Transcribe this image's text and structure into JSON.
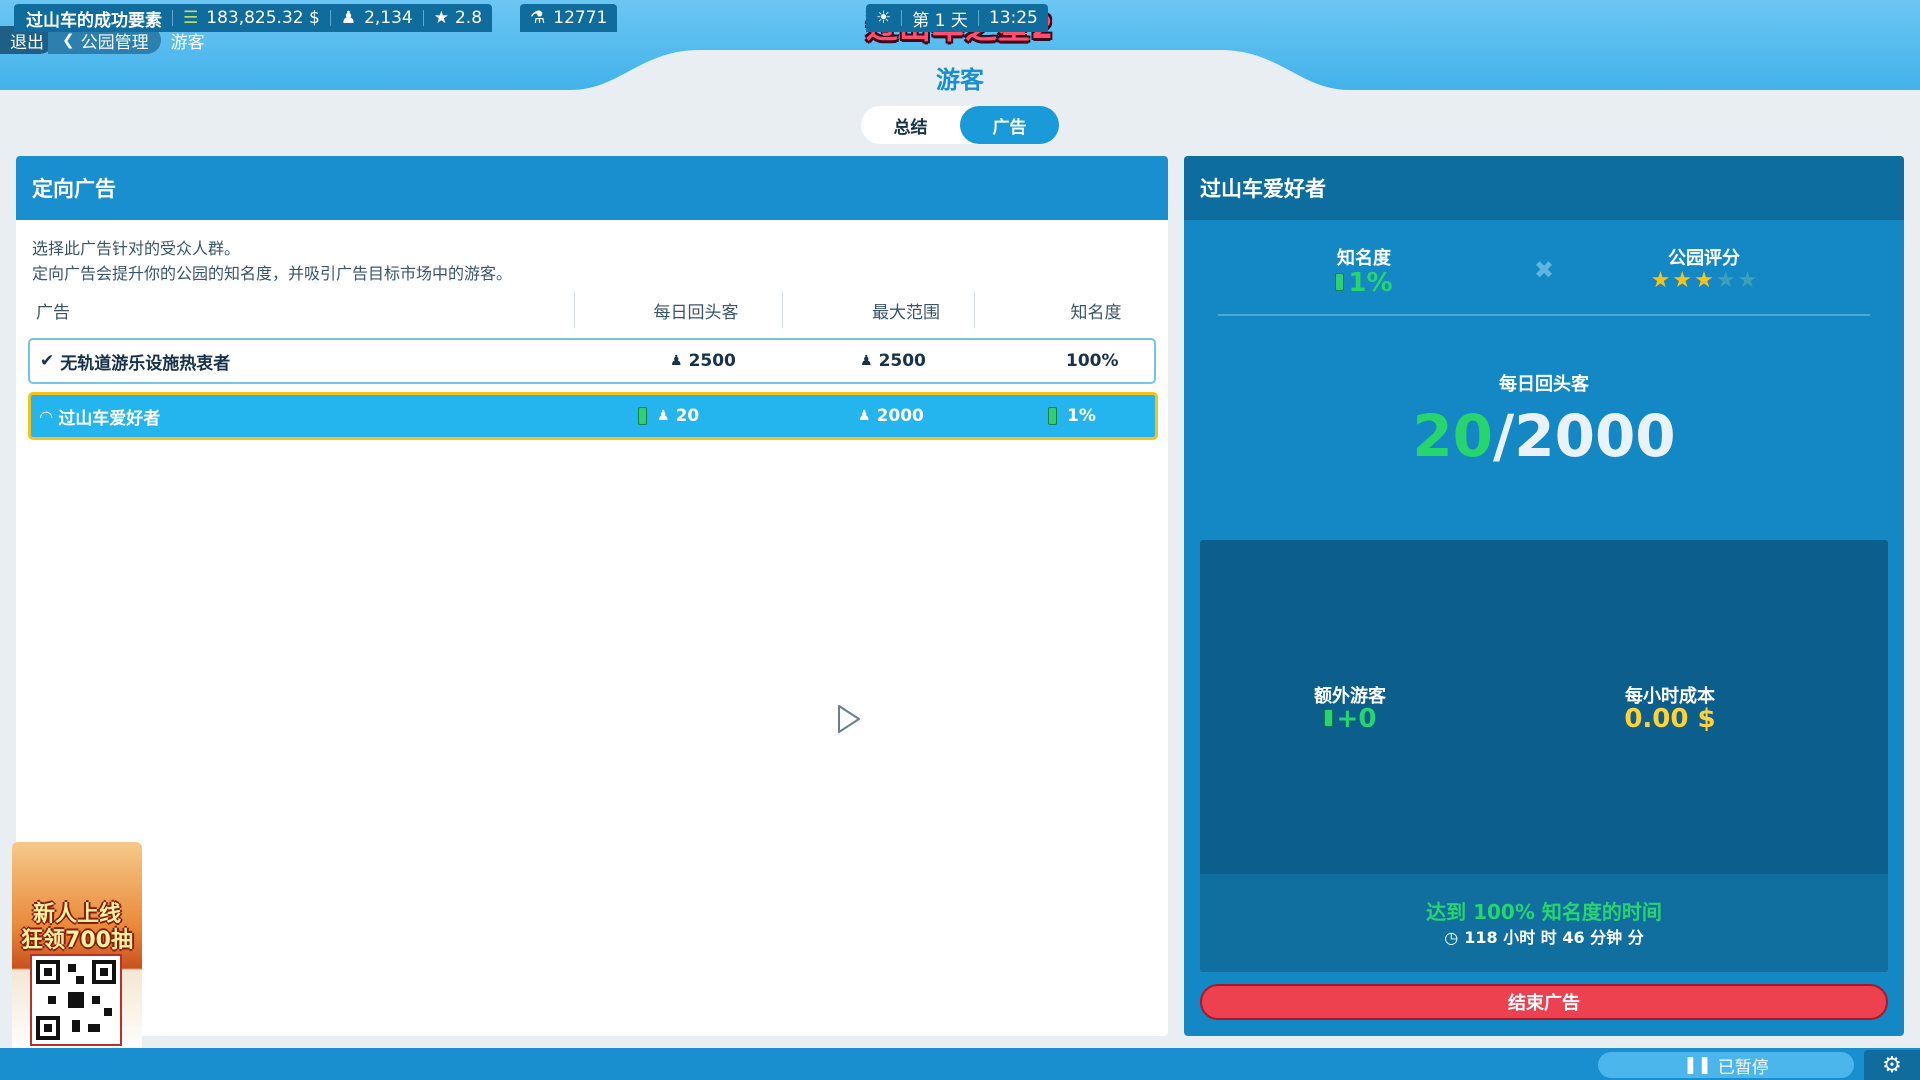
{
  "header": {
    "game_title": "过山车之星2",
    "breadcrumb": {
      "exit": "退出",
      "park_management": "公园管理",
      "current": "游客"
    },
    "page_title": "游客"
  },
  "tabs": [
    {
      "label": "总结",
      "active": false
    },
    {
      "label": "广告",
      "active": true
    }
  ],
  "left_panel": {
    "title": "定向广告",
    "description_line1": "选择此广告针对的受众人群。",
    "description_line2": "定向广告会提升你的公园的知名度，并吸引广告目标市场中的游客。",
    "columns": [
      "广告",
      "每日回头客",
      "最大范围",
      "知名度"
    ],
    "rows": [
      {
        "name": "无轨道游乐设施热衷者",
        "daily_returning": "2500",
        "max_range": "2500",
        "awareness": "100%",
        "status": "completed"
      },
      {
        "name": "过山车爱好者",
        "daily_returning": "20",
        "max_range": "2000",
        "awareness": "1%",
        "status": "in-progress"
      }
    ]
  },
  "right_panel": {
    "title": "过山车爱好者",
    "awareness_label": "知名度",
    "awareness_value": "1%",
    "park_rating_label": "公园评分",
    "park_rating_stars": 3,
    "park_rating_max": 5,
    "daily_returning_label": "每日回头客",
    "daily_returning_current": "20",
    "daily_returning_max": "/2000",
    "extra_guests_label": "额外游客",
    "extra_guests_value": "+0",
    "hourly_cost_label": "每小时成本",
    "hourly_cost_value": "0.00 $",
    "time_to_full_label": "达到 100% 知名度的时间",
    "time_to_full_value": "118 小时 时 46 分钟 分",
    "end_button": "结束广告"
  },
  "promo": {
    "line1": "新人上线",
    "line2": "狂领700抽"
  },
  "bottom_bar": {
    "objective": "过山车的成功要素",
    "money": "183,825.32 $",
    "guests": "2,134",
    "rating": "2.8",
    "research": "12771",
    "day": "第 1 天",
    "time": "13:25",
    "pause_status": "已暂停"
  },
  "colors": {
    "accent": "#1a9ad9",
    "panel_header": "#1a8fcf",
    "selected_border": "#f5c318",
    "positive": "#27d46d",
    "cost": "#ffd13b",
    "danger_button": "#ee4150"
  },
  "icons": {
    "guests": "people-icon",
    "money": "coins-icon",
    "rating": "star-icon",
    "research": "flask-icon",
    "weather": "sun-icon",
    "settings": "gear-icon",
    "timer": "clock-icon"
  }
}
